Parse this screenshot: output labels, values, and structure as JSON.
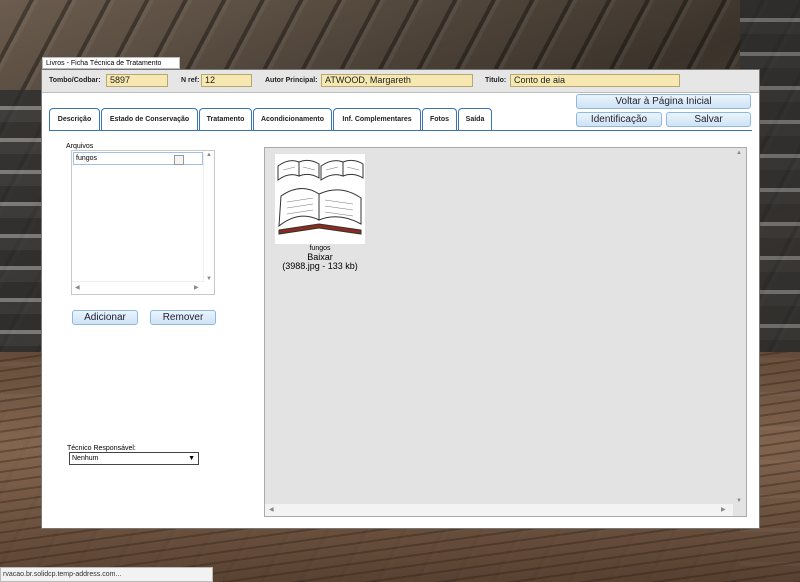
{
  "window": {
    "title": "Livros - Ficha Técnica de Tratamento"
  },
  "fields": {
    "tombo_label": "Tombo/Codbar:",
    "tombo_value": "5897",
    "nref_label": "N ref:",
    "nref_value": "12",
    "autor_label": "Autor Principal:",
    "autor_value": "ATWOOD, Margareth",
    "titulo_label": "Titulo:",
    "titulo_value": "Conto de aia"
  },
  "buttons": {
    "voltar": "Voltar à Página Inicial",
    "identificacao": "Identificação",
    "salvar": "Salvar",
    "adicionar": "Adicionar",
    "remover": "Remover"
  },
  "tabs": [
    {
      "label": "Descrição"
    },
    {
      "label": "Estado de Conservação"
    },
    {
      "label": "Tratamento"
    },
    {
      "label": "Acondicionamento"
    },
    {
      "label": "Inf. Complementares"
    },
    {
      "label": "Fotos",
      "active": true
    },
    {
      "label": "Saída"
    }
  ],
  "arquivos": {
    "label": "Arquivos",
    "items": [
      {
        "name": "fungos",
        "checked": false
      }
    ]
  },
  "tecnico": {
    "label": "Técnico Responsável:",
    "selected": "Nenhum"
  },
  "photo": {
    "caption": "fungos",
    "download": "Baixar",
    "info": "(3988.jpg - 133 kb)"
  },
  "statusbar": {
    "text": "rvacao.br.solidcp.temp-address.com..."
  },
  "colors": {
    "field_bg": "#f6e8b0",
    "button_bg": "#cfe3f5",
    "tab_border": "#3a75b0",
    "photo_panel": "#e3e3e3"
  },
  "icons": [
    "checkbox-icon",
    "scroll-up-icon",
    "scroll-down-icon",
    "scroll-left-icon",
    "scroll-right-icon",
    "dropdown-caret-icon",
    "book-image"
  ]
}
